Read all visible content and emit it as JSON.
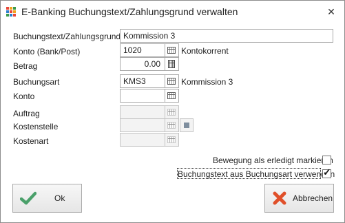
{
  "window": {
    "title": "E-Banking Buchungstext/Zahlungsgrund verwalten",
    "close_glyph": "✕",
    "app_icon": "colored-grid-icon"
  },
  "form": {
    "buchungstext": {
      "label": "Buchungstext/Zahlungsgrund",
      "value": "Kommission 3"
    },
    "konto_bank": {
      "label": "Konto (Bank/Post)",
      "value": "1020",
      "description": "Kontokorrent"
    },
    "betrag": {
      "label": "Betrag",
      "value": "0.00"
    },
    "buchungsart": {
      "label": "Buchungsart",
      "value": "KMS3",
      "description": "Kommission 3"
    },
    "konto": {
      "label": "Konto",
      "value": ""
    },
    "auftrag": {
      "label": "Auftrag",
      "value": ""
    },
    "kostenstelle": {
      "label": "Kostenstelle",
      "value": ""
    },
    "kostenart": {
      "label": "Kostenart",
      "value": ""
    }
  },
  "options": {
    "erledigt": {
      "label": "Bewegung als erledigt markieren",
      "checked": false
    },
    "buchungstext_aus_art": {
      "label": "Buchungstext aus Buchungsart verwenden",
      "checked": true,
      "check_glyph": "✓"
    }
  },
  "buttons": {
    "ok": "Ok",
    "abbrechen": "Abbrechen"
  },
  "colors": {
    "ok_green": "#4aa06a",
    "cancel_red": "#e0502a"
  }
}
